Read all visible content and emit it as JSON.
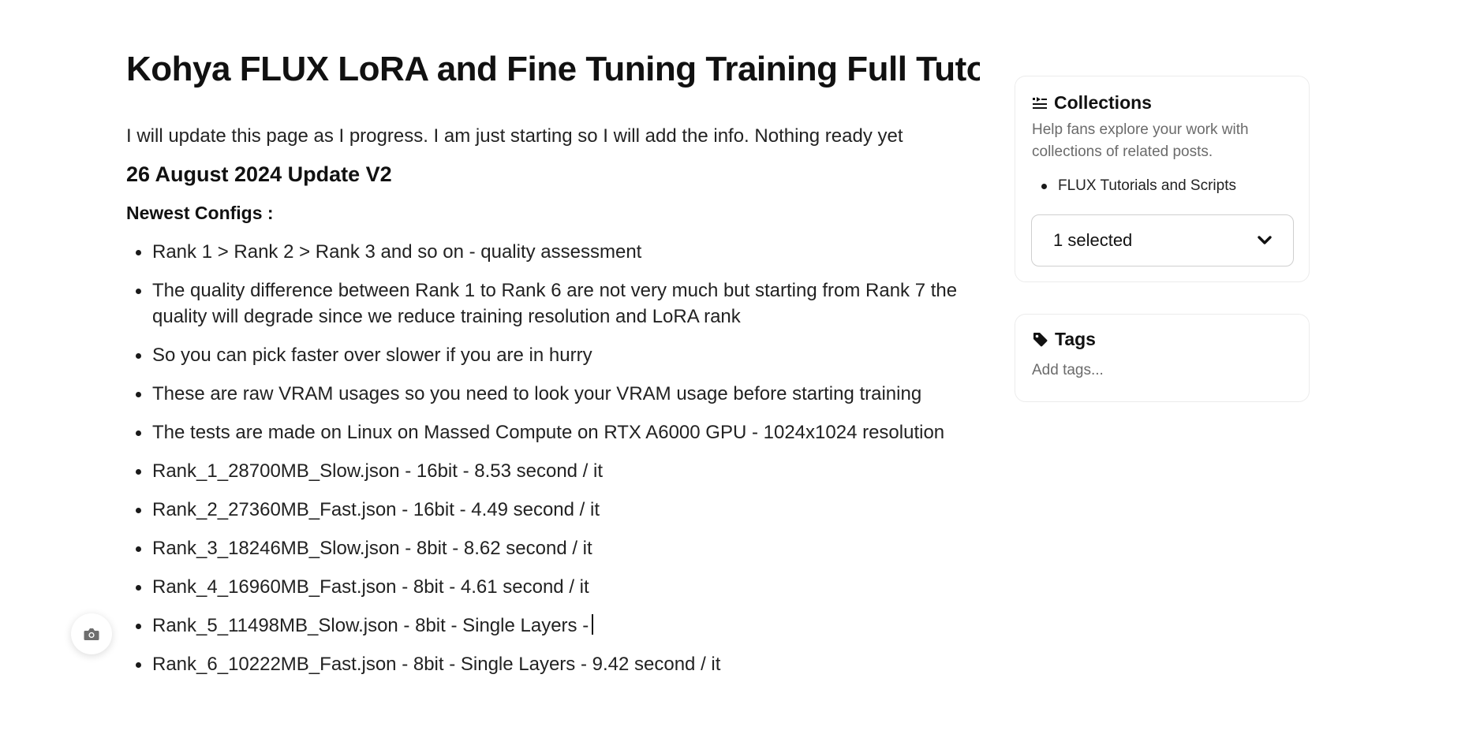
{
  "post": {
    "title": "Kohya FLUX LoRA and Fine Tuning Training Full Tutorial For Windows, RunPod and Massed Compute",
    "intro": "I will update this page as I progress. I am just starting so I will add the info. Nothing ready yet",
    "update_heading": "26 August 2024 Update V2",
    "configs_heading": "Newest Configs :",
    "bullets": [
      "Rank 1 > Rank 2 > Rank 3 and so on - quality assessment",
      "The quality difference between Rank 1 to Rank 6 are not very much but starting from Rank 7 the quality will degrade since we reduce training resolution and LoRA rank",
      "So you can pick faster over slower if you are in hurry",
      "These are raw VRAM usages so you need to look your VRAM usage before starting training",
      "The tests are made on Linux on Massed Compute on RTX A6000 GPU - 1024x1024 resolution",
      "Rank_1_28700MB_Slow.json - 16bit - 8.53 second / it",
      "Rank_2_27360MB_Fast.json - 16bit - 4.49 second / it",
      "Rank_3_18246MB_Slow.json - 8bit - 8.62 second / it",
      "Rank_4_16960MB_Fast.json - 8bit - 4.61 second / it",
      "Rank_5_11498MB_Slow.json - 8bit - Single Layers -",
      "Rank_6_10222MB_Fast.json - 8bit - Single Layers - 9.42 second / it"
    ]
  },
  "sidebar": {
    "collections": {
      "icon": "collections-icon",
      "title": "Collections",
      "description": "Help fans explore your work with collections of related posts.",
      "items": [
        "FLUX Tutorials and Scripts"
      ],
      "select_value": "1 selected",
      "select_icon": "chevron-down-icon"
    },
    "tags": {
      "icon": "tag-icon",
      "title": "Tags",
      "placeholder": "Add tags..."
    }
  },
  "fab": {
    "icon": "camera-icon"
  }
}
